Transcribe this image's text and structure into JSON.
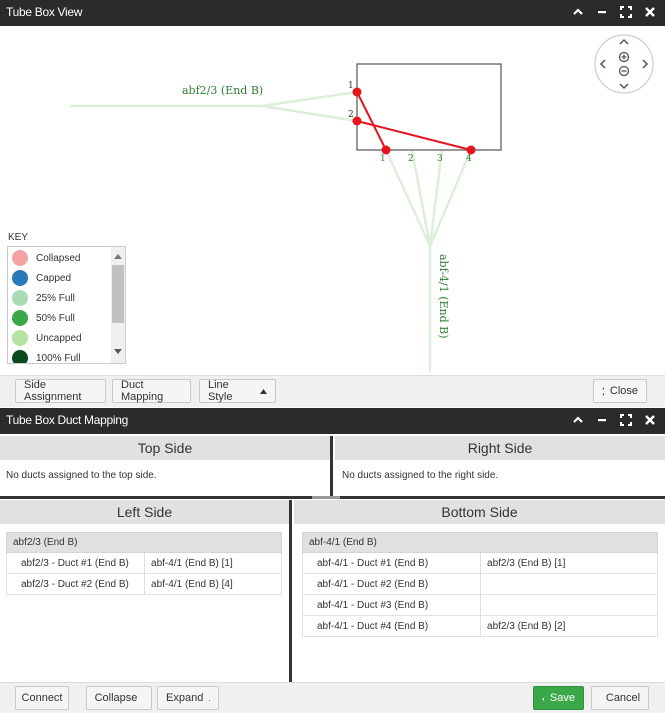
{
  "top_panel": {
    "title": "Tube Box View",
    "controls": [
      "chevron-up",
      "minimize",
      "expand",
      "close"
    ]
  },
  "diagram": {
    "left_cable_label": "abf2/3 (End B)",
    "bottom_cable_label": "abf-4/1 (End B)",
    "left_port_labels": [
      "1",
      "2"
    ],
    "bottom_port_labels": [
      "1",
      "2",
      "3",
      "4"
    ]
  },
  "key": {
    "title": "KEY",
    "items": [
      {
        "label": "Collapsed",
        "color": "#f4a3a3"
      },
      {
        "label": "Capped",
        "color": "#2a79b8"
      },
      {
        "label": "25% Full",
        "color": "#a8dbb1"
      },
      {
        "label": "50% Full",
        "color": "#3aa74a"
      },
      {
        "label": "Uncapped",
        "color": "#b6e3a0"
      },
      {
        "label": "100% Full",
        "color": "#0b4a1c"
      }
    ]
  },
  "top_toolbar": {
    "side_assignment": "Side Assignment",
    "duct_mapping": "Duct Mapping",
    "line_style": "Line Style",
    "close": "Close"
  },
  "bottom_panel": {
    "title": "Tube Box Duct Mapping"
  },
  "sides": {
    "top": {
      "title": "Top Side",
      "message": "No ducts assigned to the top side."
    },
    "right": {
      "title": "Right Side",
      "message": "No ducts assigned to the right side."
    },
    "left": {
      "title": "Left Side",
      "group": "abf2/3 (End B)",
      "rows": [
        [
          "abf2/3 - Duct #1 (End B)",
          "abf-4/1 (End B) [1]"
        ],
        [
          "abf2/3 - Duct #2 (End B)",
          "abf-4/1 (End B) [4]"
        ]
      ]
    },
    "bottom": {
      "title": "Bottom Side",
      "group": "abf-4/1 (End B)",
      "rows": [
        [
          "abf-4/1 - Duct #1 (End B)",
          "abf2/3 (End B) [1]"
        ],
        [
          "abf-4/1 - Duct #2 (End B)",
          ""
        ],
        [
          "abf-4/1 - Duct #3 (End B)",
          ""
        ],
        [
          "abf-4/1 - Duct #4 (End B)",
          "abf2/3 (End B) [2]"
        ]
      ]
    }
  },
  "bottom_toolbar": {
    "connect": "Connect",
    "collapse": "Collapse",
    "expand": "Expand",
    "save": "Save",
    "cancel": "Cancel"
  },
  "colors": {
    "header_bg": "#2b2b2b",
    "save_green": "#3aa849",
    "connection_red": "#e8141b",
    "cable_green": "#2e7d32"
  }
}
